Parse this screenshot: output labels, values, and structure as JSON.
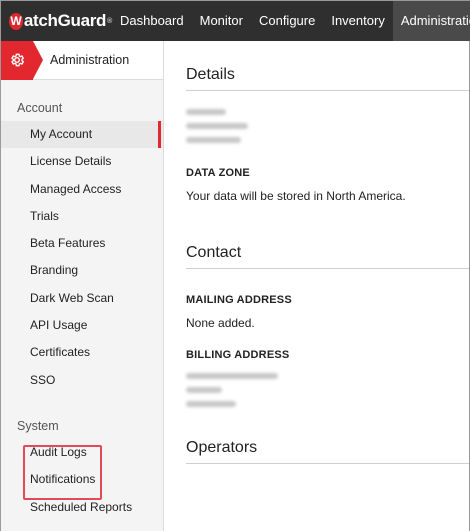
{
  "brand": {
    "logo_letter": "W",
    "logo_rest": "atchGuard",
    "tm": "®"
  },
  "nav": {
    "items": [
      {
        "label": "Dashboard"
      },
      {
        "label": "Monitor"
      },
      {
        "label": "Configure"
      },
      {
        "label": "Inventory"
      },
      {
        "label": "Administration",
        "active": true
      }
    ]
  },
  "sidebar": {
    "title": "Administration",
    "icon": "gear-icon",
    "account_label": "Account",
    "account_items": [
      {
        "label": "My Account",
        "active": true
      },
      {
        "label": "License Details"
      },
      {
        "label": "Managed Access"
      },
      {
        "label": "Trials"
      },
      {
        "label": "Beta Features"
      },
      {
        "label": "Branding"
      },
      {
        "label": "Dark Web Scan"
      },
      {
        "label": "API Usage"
      },
      {
        "label": "Certificates"
      },
      {
        "label": "SSO"
      }
    ],
    "system_label": "System",
    "system_items": [
      {
        "label": "Audit Logs",
        "highlighted": true
      },
      {
        "label": "Notifications",
        "highlighted": true
      },
      {
        "label": "Scheduled Reports"
      }
    ]
  },
  "main": {
    "details": {
      "title": "Details",
      "data_zone_heading": "DATA ZONE",
      "data_zone_text": "Your data will be stored in North America."
    },
    "contact": {
      "title": "Contact",
      "mailing_heading": "MAILING ADDRESS",
      "mailing_text": "None added.",
      "billing_heading": "BILLING ADDRESS"
    },
    "operators": {
      "title": "Operators"
    }
  },
  "colors": {
    "topbar": "#2f2f2f",
    "active_nav": "#4a4a4a",
    "accent": "#e2282e",
    "highlight_box": "#e04b57",
    "sidebar_bg": "#f4f4f4"
  }
}
